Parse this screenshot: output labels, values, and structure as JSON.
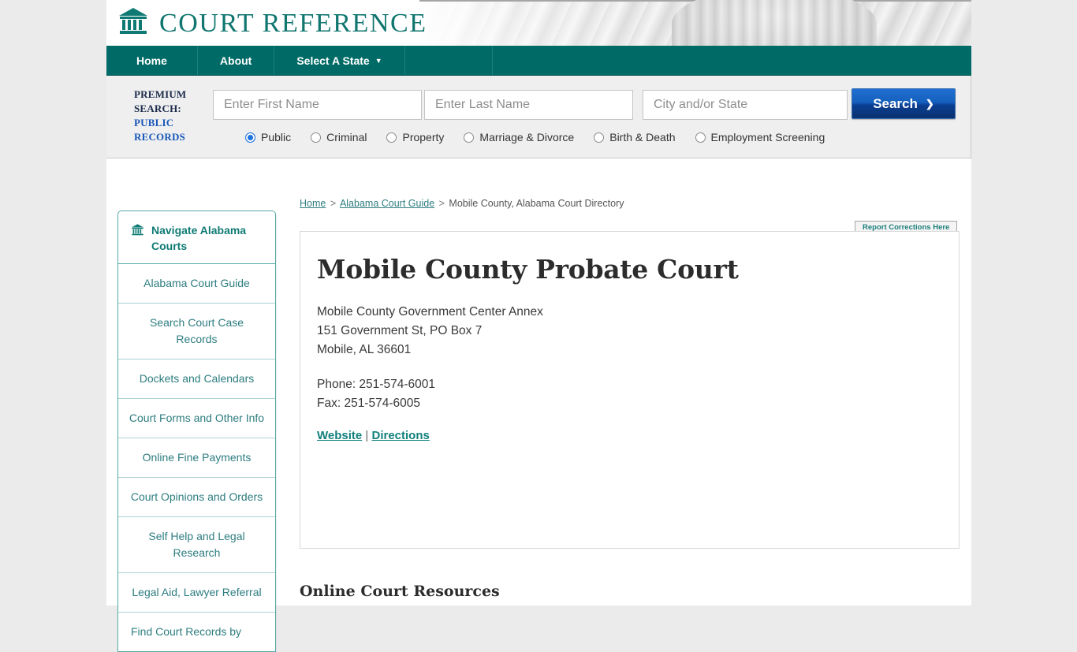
{
  "header": {
    "brand_name": "COURT REFERENCE",
    "logo_icon": "courthouse-icon"
  },
  "nav": {
    "items": [
      {
        "label": "Home"
      },
      {
        "label": "About"
      },
      {
        "label": "Select A State",
        "caret": "▼"
      }
    ]
  },
  "premium_search": {
    "label_line1": "PREMIUM",
    "label_line2": "SEARCH:",
    "label_line3": "PUBLIC",
    "label_line4": "RECORDS",
    "first_name_placeholder": "Enter First Name",
    "first_name_value": "",
    "last_name_placeholder": "Enter Last Name",
    "last_name_value": "",
    "city_state_placeholder": "City and/or State",
    "city_state_value": "",
    "search_button_label": "Search",
    "search_button_chevron": "❯",
    "radio_options": [
      {
        "label": "Public",
        "selected": true
      },
      {
        "label": "Criminal",
        "selected": false
      },
      {
        "label": "Property",
        "selected": false
      },
      {
        "label": "Marriage & Divorce",
        "selected": false
      },
      {
        "label": "Birth & Death",
        "selected": false
      },
      {
        "label": "Employment Screening",
        "selected": false
      }
    ],
    "accent_button_color": "#0b3f92"
  },
  "breadcrumb": {
    "home": "Home",
    "sep1": ">",
    "guide": "Alabama Court Guide",
    "sep2": ">",
    "current": "Mobile County, Alabama Court Directory"
  },
  "report_corrections": {
    "label": "Report Corrections Here"
  },
  "sidebar": {
    "heading": "Navigate Alabama Courts",
    "heading_icon": "courthouse-icon",
    "items": [
      {
        "label": "Alabama Court Guide"
      },
      {
        "label": "Search Court Case Records"
      },
      {
        "label": "Dockets and Calendars"
      },
      {
        "label": "Court Forms and Other Info"
      },
      {
        "label": "Online Fine Payments"
      },
      {
        "label": "Court Opinions and Orders"
      },
      {
        "label": "Self Help and Legal Research"
      },
      {
        "label": "Legal Aid, Lawyer Referral"
      },
      {
        "label": "Find Court Records by"
      }
    ]
  },
  "court": {
    "title": "Mobile County Probate Court",
    "address_line1": "Mobile County Government Center Annex",
    "address_line2": "151 Government St, PO Box 7",
    "address_line3": "Mobile, AL 36601",
    "phone": "Phone: 251-574-6001",
    "fax": "Fax: 251-574-6005",
    "website_link": "Website",
    "link_separator": "|",
    "directions_link": "Directions"
  },
  "main": {
    "resources_heading": "Online Court Resources"
  },
  "colors": {
    "teal": "#006b66",
    "link_teal": "#2f7d80",
    "brand_teal": "#10766f",
    "blue_button": "#0b3f92"
  }
}
